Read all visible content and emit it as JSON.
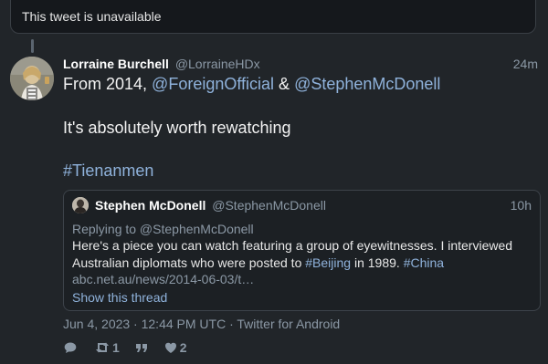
{
  "unavailable_notice": "This tweet is unavailable",
  "tweet": {
    "author_name": "Lorraine Burchell",
    "author_handle": "@LorraineHDx",
    "time_ago": "24m",
    "text": {
      "line1_prefix": "From 2014, ",
      "mention1": "@ForeignOfficial",
      "line1_and": " & ",
      "mention2": "@StephenMcDonell",
      "line2": "It's absolutely worth rewatching",
      "hashtag": "#Tienanmen"
    },
    "meta": "Jun 4, 2023 · 12:44 PM UTC · Twitter for Android",
    "stats": {
      "retweets": "1",
      "likes": "2"
    }
  },
  "quoted": {
    "author_name": "Stephen McDonell",
    "author_handle": "@StephenMcDonell",
    "time_ago": "10h",
    "replying_to": "Replying to @StephenMcDonell",
    "body_part1": "Here's a piece you can watch featuring a group of eyewitnesses. I interviewed Australian diplomats who were posted to ",
    "hashtag1": "#Beijing",
    "body_part2": " in 1989. ",
    "hashtag2": "#China",
    "url": "abc.net.au/news/2014-06-03/t…",
    "show_thread": "Show this thread"
  },
  "icons": {
    "reply": "comment-icon",
    "retweet": "retweet-icon",
    "quote": "quote-icon",
    "like": "heart-icon"
  }
}
